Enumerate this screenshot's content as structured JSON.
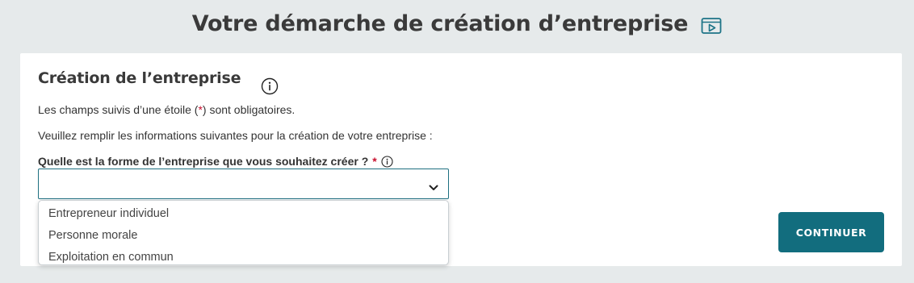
{
  "header": {
    "title": "Votre démarche de création d’entreprise",
    "video_icon": "video-play-icon"
  },
  "form": {
    "section_title": "Création de l’entreprise",
    "section_info_icon": "info-icon",
    "required_note_prefix": "Les champs suivis d’une étoile (",
    "required_star": "*",
    "required_note_suffix": ") sont obligatoires.",
    "instructions": "Veuillez remplir les informations suivantes pour la création de votre entreprise :",
    "field": {
      "label": "Quelle est la forme de l’entreprise que vous souhaitez créer ?",
      "required_star": "*",
      "info_icon": "info-icon",
      "selected_value": "",
      "expanded": true,
      "options": [
        "Entrepreneur individuel",
        "Personne morale",
        "Exploitation en commun"
      ]
    },
    "continue_label": "CONTINUER"
  },
  "colors": {
    "page_background": "#e6eaeb",
    "accent": "#126d7e",
    "required": "#c8102e",
    "text": "#333333"
  }
}
